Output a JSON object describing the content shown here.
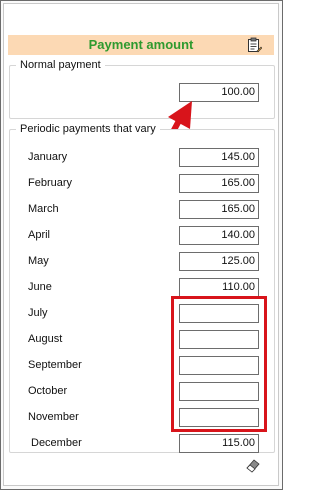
{
  "header": {
    "title": "Payment amount",
    "icon": "clipboard-edit-icon"
  },
  "normal": {
    "group_title": "Normal payment",
    "value": "100.00"
  },
  "periodic": {
    "group_title": "Periodic payments that vary",
    "months": [
      {
        "label": "January",
        "value": "145.00"
      },
      {
        "label": "February",
        "value": "165.00"
      },
      {
        "label": "March",
        "value": "165.00"
      },
      {
        "label": "April",
        "value": "140.00"
      },
      {
        "label": "May",
        "value": "125.00"
      },
      {
        "label": "June",
        "value": "110.00"
      },
      {
        "label": "July",
        "value": ""
      },
      {
        "label": "August",
        "value": ""
      },
      {
        "label": "September",
        "value": ""
      },
      {
        "label": "October",
        "value": ""
      },
      {
        "label": "November",
        "value": ""
      },
      {
        "label": "December",
        "value": "115.00"
      }
    ]
  },
  "annotations": {
    "arrow_color": "#d8141b",
    "highlight_color": "#d8141b"
  },
  "footer": {
    "icon": "eraser-icon"
  }
}
